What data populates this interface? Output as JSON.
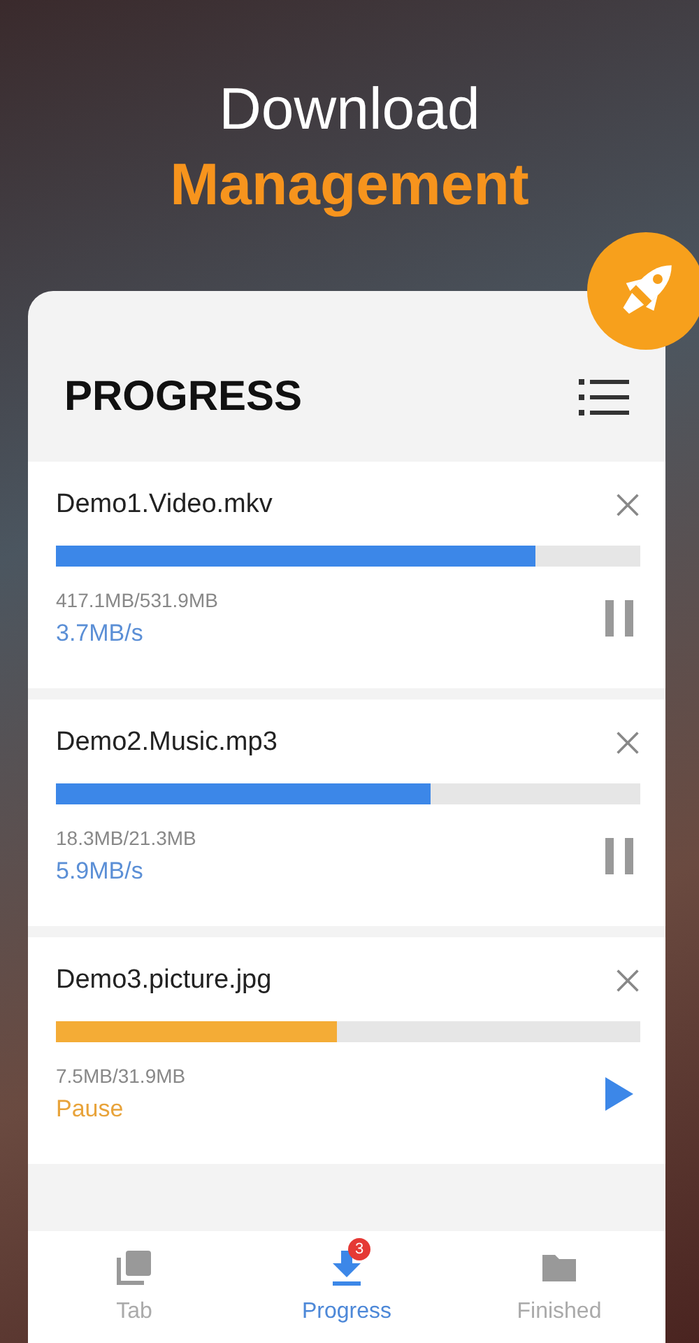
{
  "headline": {
    "line_1": "Download",
    "line_2": "Management"
  },
  "header": {
    "title": "PROGRESS"
  },
  "downloads": [
    {
      "name": "Demo1.Video.mkv",
      "level": 0.82,
      "size": "417.1MB/531.9MB",
      "status": "3.7MB/s",
      "paused": false
    },
    {
      "name": "Demo2.Music.mp3",
      "level": 0.64,
      "size": "18.3MB/21.3MB",
      "status": "5.9MB/s",
      "paused": false
    },
    {
      "name": "Demo3.picture.jpg",
      "level": 0.48,
      "size": "7.5MB/31.9MB",
      "status": "Pause",
      "paused": true
    }
  ],
  "tabs": [
    {
      "label": "Tab",
      "kind": "tabs",
      "selected": false
    },
    {
      "label": "Progress",
      "kind": "download",
      "selected": true,
      "badge": "3"
    },
    {
      "label": "Finished",
      "kind": "folder",
      "selected": false
    }
  ]
}
